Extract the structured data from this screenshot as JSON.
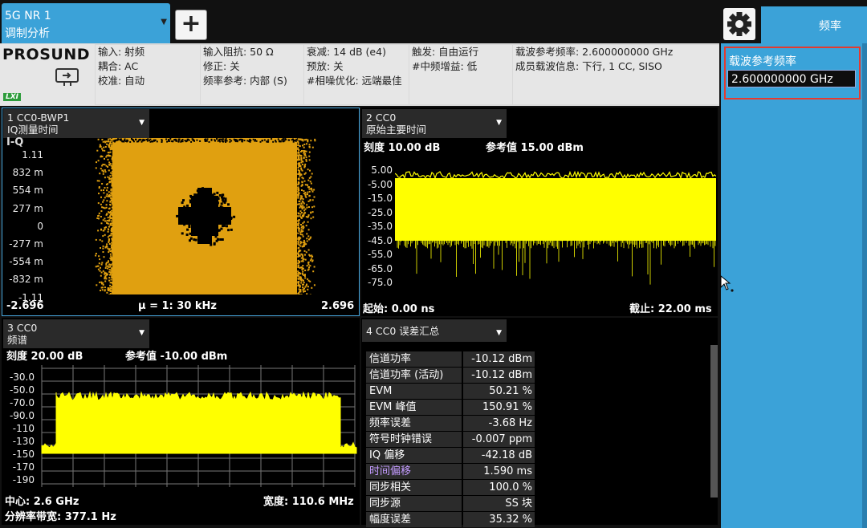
{
  "top": {
    "mode_line1": "5G NR 1",
    "mode_line2": "调制分析",
    "add_label": "+",
    "menu_title": "频率"
  },
  "logo": {
    "brand": "PROSUND",
    "lxi": "LXI"
  },
  "info": [
    [
      "输入: 射频",
      "耦合: AC",
      "校准: 自动"
    ],
    [
      "输入阻抗: 50 Ω",
      "修正: 关",
      "频率参考: 内部 (S)"
    ],
    [
      "衰减: 14 dB (e4)",
      "预放: 关",
      "#相噪优化: 远端最佳"
    ],
    [
      "触发: 自由运行",
      "#中频增益: 低"
    ],
    [
      "载波参考频率: 2.600000000 GHz",
      "成员载波信息: 下行, 1 CC, SISO"
    ]
  ],
  "panel": {
    "cf_label": "载波参考频率",
    "cf_value": "2.600000000 GHz"
  },
  "win1": {
    "tab_line1": "1 CC0-BWP1",
    "tab_line2": "IQ测量时间",
    "axis_name": "I-Q",
    "yticks": [
      "1.11",
      "832 m",
      "554 m",
      "277 m",
      "0",
      "-277 m",
      "-554 m",
      "-832 m",
      "-1.11"
    ],
    "x_left": "-2.696",
    "x_center": "μ = 1: 30 kHz",
    "x_right": "2.696",
    "cloud_color": "#e0a010"
  },
  "win2": {
    "tab_line1": "2 CC0",
    "tab_line2": "原始主要时间",
    "scale": "刻度 10.00 dB",
    "ref": "参考值 15.00 dBm",
    "yticks": [
      "5.00",
      "-5.00",
      "-15.0",
      "-25.0",
      "-35.0",
      "-45.0",
      "-55.0",
      "-65.0",
      "-75.0"
    ],
    "x_start": "起始: 0.00 ns",
    "x_stop": "截止: 22.00 ms",
    "trace_color": "#ffff00"
  },
  "win3": {
    "tab_line1": "3 CC0",
    "tab_line2": "频谱",
    "scale": "刻度 20.00 dB",
    "ref": "参考值 -10.00 dBm",
    "yticks": [
      "-30.0",
      "-50.0",
      "-70.0",
      "-90.0",
      "-110",
      "-130",
      "-150",
      "-170",
      "-190"
    ],
    "center": "中心: 2.6 GHz",
    "span": "宽度: 110.6 MHz",
    "rbw": "分辨率带宽: 377.1 Hz"
  },
  "win4": {
    "tab_line1": "4 CC0 误差汇总",
    "rows": [
      {
        "k": "信道功率",
        "v": "-10.12 dBm"
      },
      {
        "k": "信道功率 (活动)",
        "v": "-10.12 dBm"
      },
      {
        "k": "EVM",
        "v": "50.21 %"
      },
      {
        "k": "EVM 峰值",
        "v": "150.91 %"
      },
      {
        "k": "频率误差",
        "v": "-3.68 Hz"
      },
      {
        "k": "符号时钟错误",
        "v": "-0.007 ppm"
      },
      {
        "k": "IQ 偏移",
        "v": "-42.18 dB"
      },
      {
        "k": "时间偏移",
        "v": "1.590 ms"
      },
      {
        "k": "同步相关",
        "v": "100.0 %"
      },
      {
        "k": "同步源",
        "v": "SS 块"
      },
      {
        "k": "幅度误差",
        "v": "35.32 %"
      }
    ]
  }
}
